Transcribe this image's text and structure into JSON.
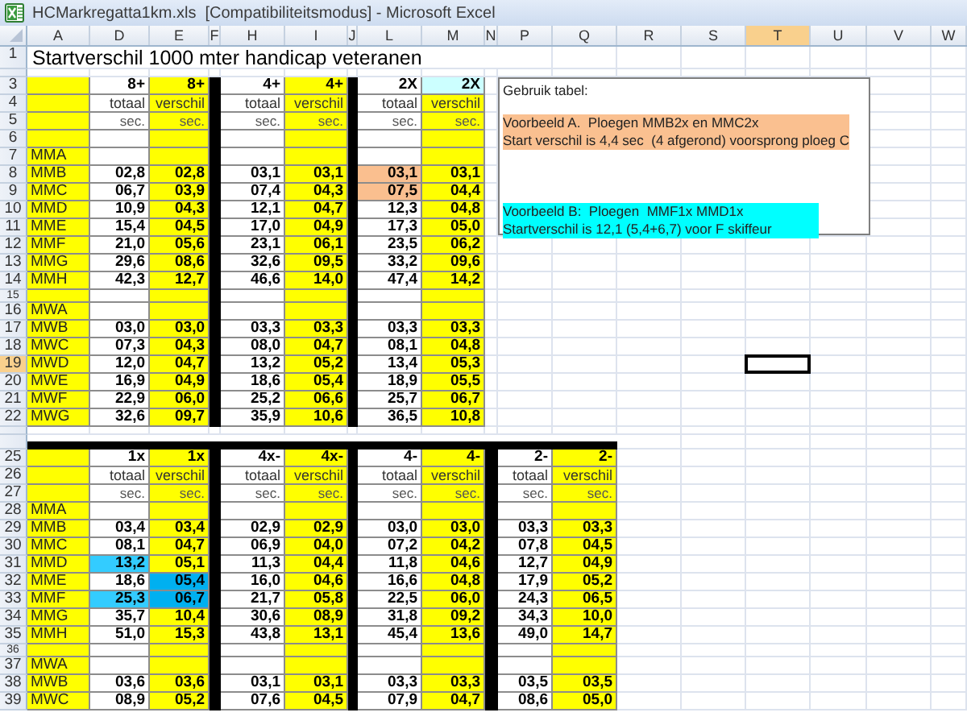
{
  "window": {
    "title": "HCMarkregatta1km.xls  [Compatibiliteitsmodus] - Microsoft Excel"
  },
  "column_headers": [
    {
      "label": "A",
      "selected": false
    },
    {
      "label": "D",
      "selected": false
    },
    {
      "label": "E",
      "selected": false
    },
    {
      "label": "F",
      "selected": false
    },
    {
      "label": "H",
      "selected": false
    },
    {
      "label": "I",
      "selected": false
    },
    {
      "label": "J",
      "selected": false
    },
    {
      "label": "L",
      "selected": false
    },
    {
      "label": "M",
      "selected": false
    },
    {
      "label": "N",
      "selected": false
    },
    {
      "label": "P",
      "selected": false
    },
    {
      "label": "Q",
      "selected": false
    },
    {
      "label": "R",
      "selected": false
    },
    {
      "label": "S",
      "selected": false
    },
    {
      "label": "T",
      "selected": true
    },
    {
      "label": "U",
      "selected": false
    },
    {
      "label": "V",
      "selected": false
    },
    {
      "label": "W",
      "selected": false
    }
  ],
  "rows": [
    {
      "number": "1",
      "selected": false,
      "kind": "title",
      "text": "Startverschil 1000 mter handicap veteranen"
    },
    {
      "selected": false,
      "kind": "spacer"
    },
    {
      "number": "3",
      "selected": false,
      "kind": "boats",
      "cells": [
        "8+",
        "8+",
        "4+",
        "4+",
        "2X",
        {
          "text": "2X",
          "color": "#ccffff"
        }
      ]
    },
    {
      "number": "4",
      "selected": false,
      "kind": "labels",
      "cells": [
        "totaal",
        "verschil",
        "totaal",
        "verschil",
        "totaal",
        "verschil"
      ]
    },
    {
      "number": "5",
      "selected": false,
      "kind": "units",
      "cells": [
        "sec.",
        "sec.",
        "sec.",
        "sec.",
        "sec.",
        "sec."
      ]
    },
    {
      "number": "6",
      "selected": false,
      "kind": "data",
      "cells": []
    },
    {
      "number": "7",
      "selected": false,
      "kind": "data",
      "label": "MMA",
      "cells": []
    },
    {
      "number": "8",
      "selected": false,
      "kind": "data",
      "label": "MMB",
      "cells": [
        "02,8",
        "02,8",
        "03,1",
        "03,1",
        {
          "text": "03,1",
          "color": "#fabf8f"
        },
        "03,1"
      ]
    },
    {
      "number": "9",
      "selected": false,
      "kind": "data",
      "label": "MMC",
      "cells": [
        "06,7",
        "03,9",
        "07,4",
        "04,3",
        {
          "text": "07,5",
          "color": "#fabf8f"
        },
        "04,4"
      ]
    },
    {
      "number": "10",
      "selected": false,
      "kind": "data",
      "label": "MMD",
      "cells": [
        "10,9",
        "04,3",
        "12,1",
        "04,7",
        "12,3",
        "04,8"
      ]
    },
    {
      "number": "11",
      "selected": false,
      "kind": "data",
      "label": "MME",
      "cells": [
        "15,4",
        "04,5",
        "17,0",
        "04,9",
        "17,3",
        "05,0"
      ]
    },
    {
      "number": "12",
      "selected": false,
      "kind": "data",
      "label": "MMF",
      "cells": [
        "21,0",
        "05,6",
        "23,1",
        "06,1",
        "23,5",
        "06,2"
      ]
    },
    {
      "number": "13",
      "selected": false,
      "kind": "data",
      "label": "MMG",
      "cells": [
        "29,6",
        "08,6",
        "32,6",
        "09,5",
        "33,2",
        "09,6"
      ]
    },
    {
      "number": "14",
      "selected": false,
      "kind": "data",
      "label": "MMH",
      "cells": [
        "42,3",
        "12,7",
        "46,6",
        "14,0",
        "47,4",
        "14,2"
      ]
    },
    {
      "number": "15",
      "selected": false,
      "kind": "gap",
      "cells": []
    },
    {
      "number": "16",
      "selected": false,
      "kind": "data",
      "label": "MWA",
      "cells": []
    },
    {
      "number": "17",
      "selected": false,
      "kind": "data",
      "label": "MWB",
      "cells": [
        "03,0",
        "03,0",
        "03,3",
        "03,3",
        "03,3",
        "03,3"
      ]
    },
    {
      "number": "18",
      "selected": false,
      "kind": "data",
      "label": "MWC",
      "cells": [
        "07,3",
        "04,3",
        "08,0",
        "04,7",
        "08,1",
        "04,8"
      ]
    },
    {
      "number": "19",
      "selected": true,
      "kind": "data",
      "label": "MWD",
      "cells": [
        "12,0",
        "04,7",
        "13,2",
        "05,2",
        "13,4",
        "05,3"
      ]
    },
    {
      "number": "20",
      "selected": false,
      "kind": "data",
      "label": "MWE",
      "cells": [
        "16,9",
        "04,9",
        "18,6",
        "05,4",
        "18,9",
        "05,5"
      ]
    },
    {
      "number": "21",
      "selected": false,
      "kind": "data",
      "label": "MWF",
      "cells": [
        "22,9",
        "06,0",
        "25,2",
        "06,6",
        "25,7",
        "06,7"
      ]
    },
    {
      "number": "22",
      "selected": false,
      "kind": "data",
      "label": "MWG",
      "cells": [
        "32,6",
        "09,7",
        "35,9",
        "10,6",
        "36,5",
        "10,8"
      ]
    },
    {
      "selected": false,
      "kind": "spacer"
    },
    {
      "selected": false,
      "kind": "rule"
    },
    {
      "number": "25",
      "selected": false,
      "kind": "boats",
      "cells": [
        "1x",
        "1x",
        "4x-",
        "4x-",
        "4-",
        "4-",
        "2-",
        "2-"
      ]
    },
    {
      "number": "26",
      "selected": false,
      "kind": "labels",
      "cells": [
        "totaal",
        "verschil",
        "totaal",
        "verschil",
        "totaal",
        "verschil",
        "totaal",
        "verschil"
      ]
    },
    {
      "number": "27",
      "selected": false,
      "kind": "units",
      "cells": [
        "sec.",
        "sec.",
        "sec.",
        "sec.",
        "sec.",
        "sec.",
        "sec.",
        "sec."
      ]
    },
    {
      "number": "28",
      "selected": false,
      "kind": "data",
      "label": "MMA",
      "cells": []
    },
    {
      "number": "29",
      "selected": false,
      "kind": "data",
      "label": "MMB",
      "cells": [
        "03,4",
        "03,4",
        "02,9",
        "02,9",
        "03,0",
        "03,0",
        "03,3",
        "03,3"
      ]
    },
    {
      "number": "30",
      "selected": false,
      "kind": "data",
      "label": "MMC",
      "cells": [
        "08,1",
        "04,7",
        "06,9",
        "04,0",
        "07,2",
        "04,2",
        "07,8",
        "04,5"
      ]
    },
    {
      "number": "31",
      "selected": false,
      "kind": "data",
      "label": "MMD",
      "cells": [
        {
          "text": "13,2",
          "color": "#33ccff"
        },
        "05,1",
        "11,3",
        "04,4",
        "11,8",
        "04,6",
        "12,7",
        "04,9"
      ]
    },
    {
      "number": "32",
      "selected": false,
      "kind": "data",
      "label": "MME",
      "cells": [
        "18,6",
        {
          "text": "05,4",
          "color": "#00b0f0"
        },
        "16,0",
        "04,6",
        "16,6",
        "04,8",
        "17,9",
        "05,2"
      ]
    },
    {
      "number": "33",
      "selected": false,
      "kind": "data",
      "label": "MMF",
      "cells": [
        {
          "text": "25,3",
          "color": "#33ccff"
        },
        {
          "text": "06,7",
          "color": "#00b0f0"
        },
        "21,7",
        "05,8",
        "22,5",
        "06,0",
        "24,3",
        "06,5"
      ]
    },
    {
      "number": "34",
      "selected": false,
      "kind": "data",
      "label": "MMG",
      "cells": [
        "35,7",
        "10,4",
        "30,6",
        "08,9",
        "31,8",
        "09,2",
        "34,3",
        "10,0"
      ]
    },
    {
      "number": "35",
      "selected": false,
      "kind": "data",
      "label": "MMH",
      "cells": [
        "51,0",
        "15,3",
        "43,8",
        "13,1",
        "45,4",
        "13,6",
        "49,0",
        "14,7"
      ]
    },
    {
      "number": "36",
      "selected": false,
      "kind": "gap",
      "cells": []
    },
    {
      "number": "37",
      "selected": false,
      "kind": "data",
      "label": "MWA",
      "cells": []
    },
    {
      "number": "38",
      "selected": false,
      "kind": "data",
      "label": "MWB",
      "cells": [
        "03,6",
        "03,6",
        "03,1",
        "03,1",
        "03,3",
        "03,3",
        "03,5",
        "03,5"
      ]
    },
    {
      "number": "39",
      "selected": false,
      "kind": "data",
      "label": "MWC",
      "cells": [
        "08,9",
        "05,2",
        "07,6",
        "04,5",
        "07,9",
        "04,7",
        "08,6",
        "05,0"
      ]
    }
  ],
  "note_box": {
    "blocks": [
      {
        "kind": "plain",
        "lines": [
          "Gebruik tabel:"
        ]
      },
      {
        "kind": "example",
        "color": "#fac090",
        "lines": [
          "Voorbeeld A.  Ploegen MMB2x en MMC2x",
          "Start verschil is 4,4 sec  (4 afgerond) voorsprong ploeg C"
        ]
      },
      {
        "kind": "example",
        "color": "#00ffff",
        "lines": [
          "Voorbeeld B:  Ploegen  MMF1x MMD1x",
          "Startverschil is 12,1 (5,4+6,7) voor F skiffeur"
        ]
      }
    ]
  }
}
